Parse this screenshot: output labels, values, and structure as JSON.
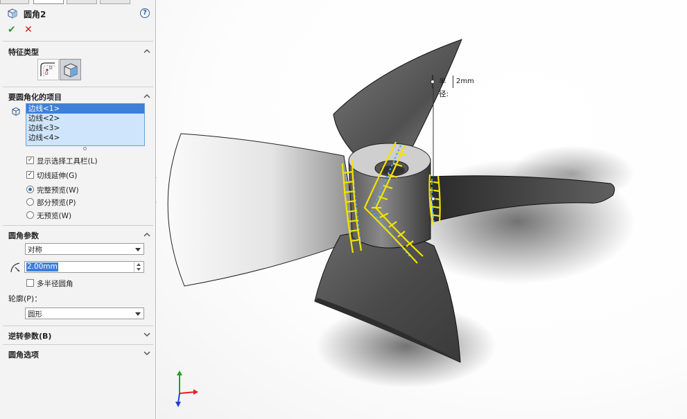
{
  "panel": {
    "title": "圆角2",
    "help_glyph": "?",
    "ok_glyph": "✔",
    "cancel_glyph": "✕",
    "sections": {
      "feature_type": "特征类型",
      "items_to_fillet": "要圆角化的项目",
      "fillet_params": "圆角参数",
      "setback_params": "逆转参数(B)",
      "fillet_options": "圆角选项"
    },
    "edges": [
      "边线<1>",
      "边线<2>",
      "边线<3>",
      "边线<4>"
    ],
    "selected_edge_index": 0,
    "checkboxes": {
      "show_selection_toolbar": "显示选择工具栏(L)",
      "tangent_propagation": "切线延伸(G)",
      "multi_radius": "多半径圆角"
    },
    "checkbox_states": {
      "show_selection_toolbar": true,
      "tangent_propagation": true,
      "multi_radius": false
    },
    "radios": {
      "full_preview": "完整预览(W)",
      "partial_preview": "部分预览(P)",
      "no_preview": "无预览(W)"
    },
    "selected_radio": "full_preview",
    "fillet_method": "对称",
    "radius_value": "2.00mm",
    "profile_label": "轮廓(P)：",
    "profile_value": "圆形"
  },
  "viewport": {
    "callout_label": "半径:",
    "callout_value": "2mm",
    "colors": {
      "edge_highlight": "#f3e300",
      "edge_selected": "#4aa8f0",
      "axis_x": "#e02020",
      "axis_y": "#20a020",
      "axis_z": "#2040e0"
    }
  }
}
